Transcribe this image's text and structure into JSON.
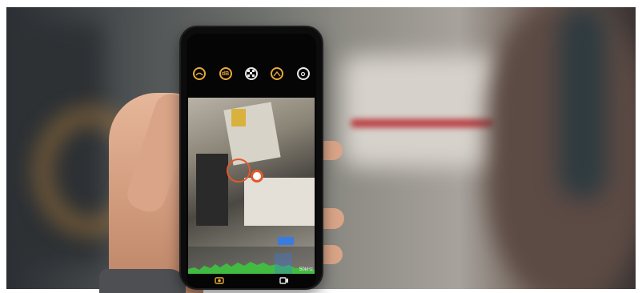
{
  "camera_app": {
    "top_icons": [
      {
        "icon": "leak-icon",
        "label": ""
      },
      {
        "icon": "decibel-icon",
        "label": "dB"
      },
      {
        "icon": "pattern-icon",
        "label": ""
      },
      {
        "icon": "gauge-icon",
        "label": ""
      },
      {
        "icon": "settings-icon",
        "label": ""
      }
    ],
    "frequency_label": "50kHz",
    "bottom_icons": [
      {
        "icon": "camera-mode-icon"
      },
      {
        "icon": "video-mode-icon"
      }
    ]
  },
  "colors": {
    "accent": "#e6a93a",
    "marker": "#e2592c",
    "spectrum_green": "#3ec43e",
    "spectrum_blue": "#3a7be0"
  }
}
